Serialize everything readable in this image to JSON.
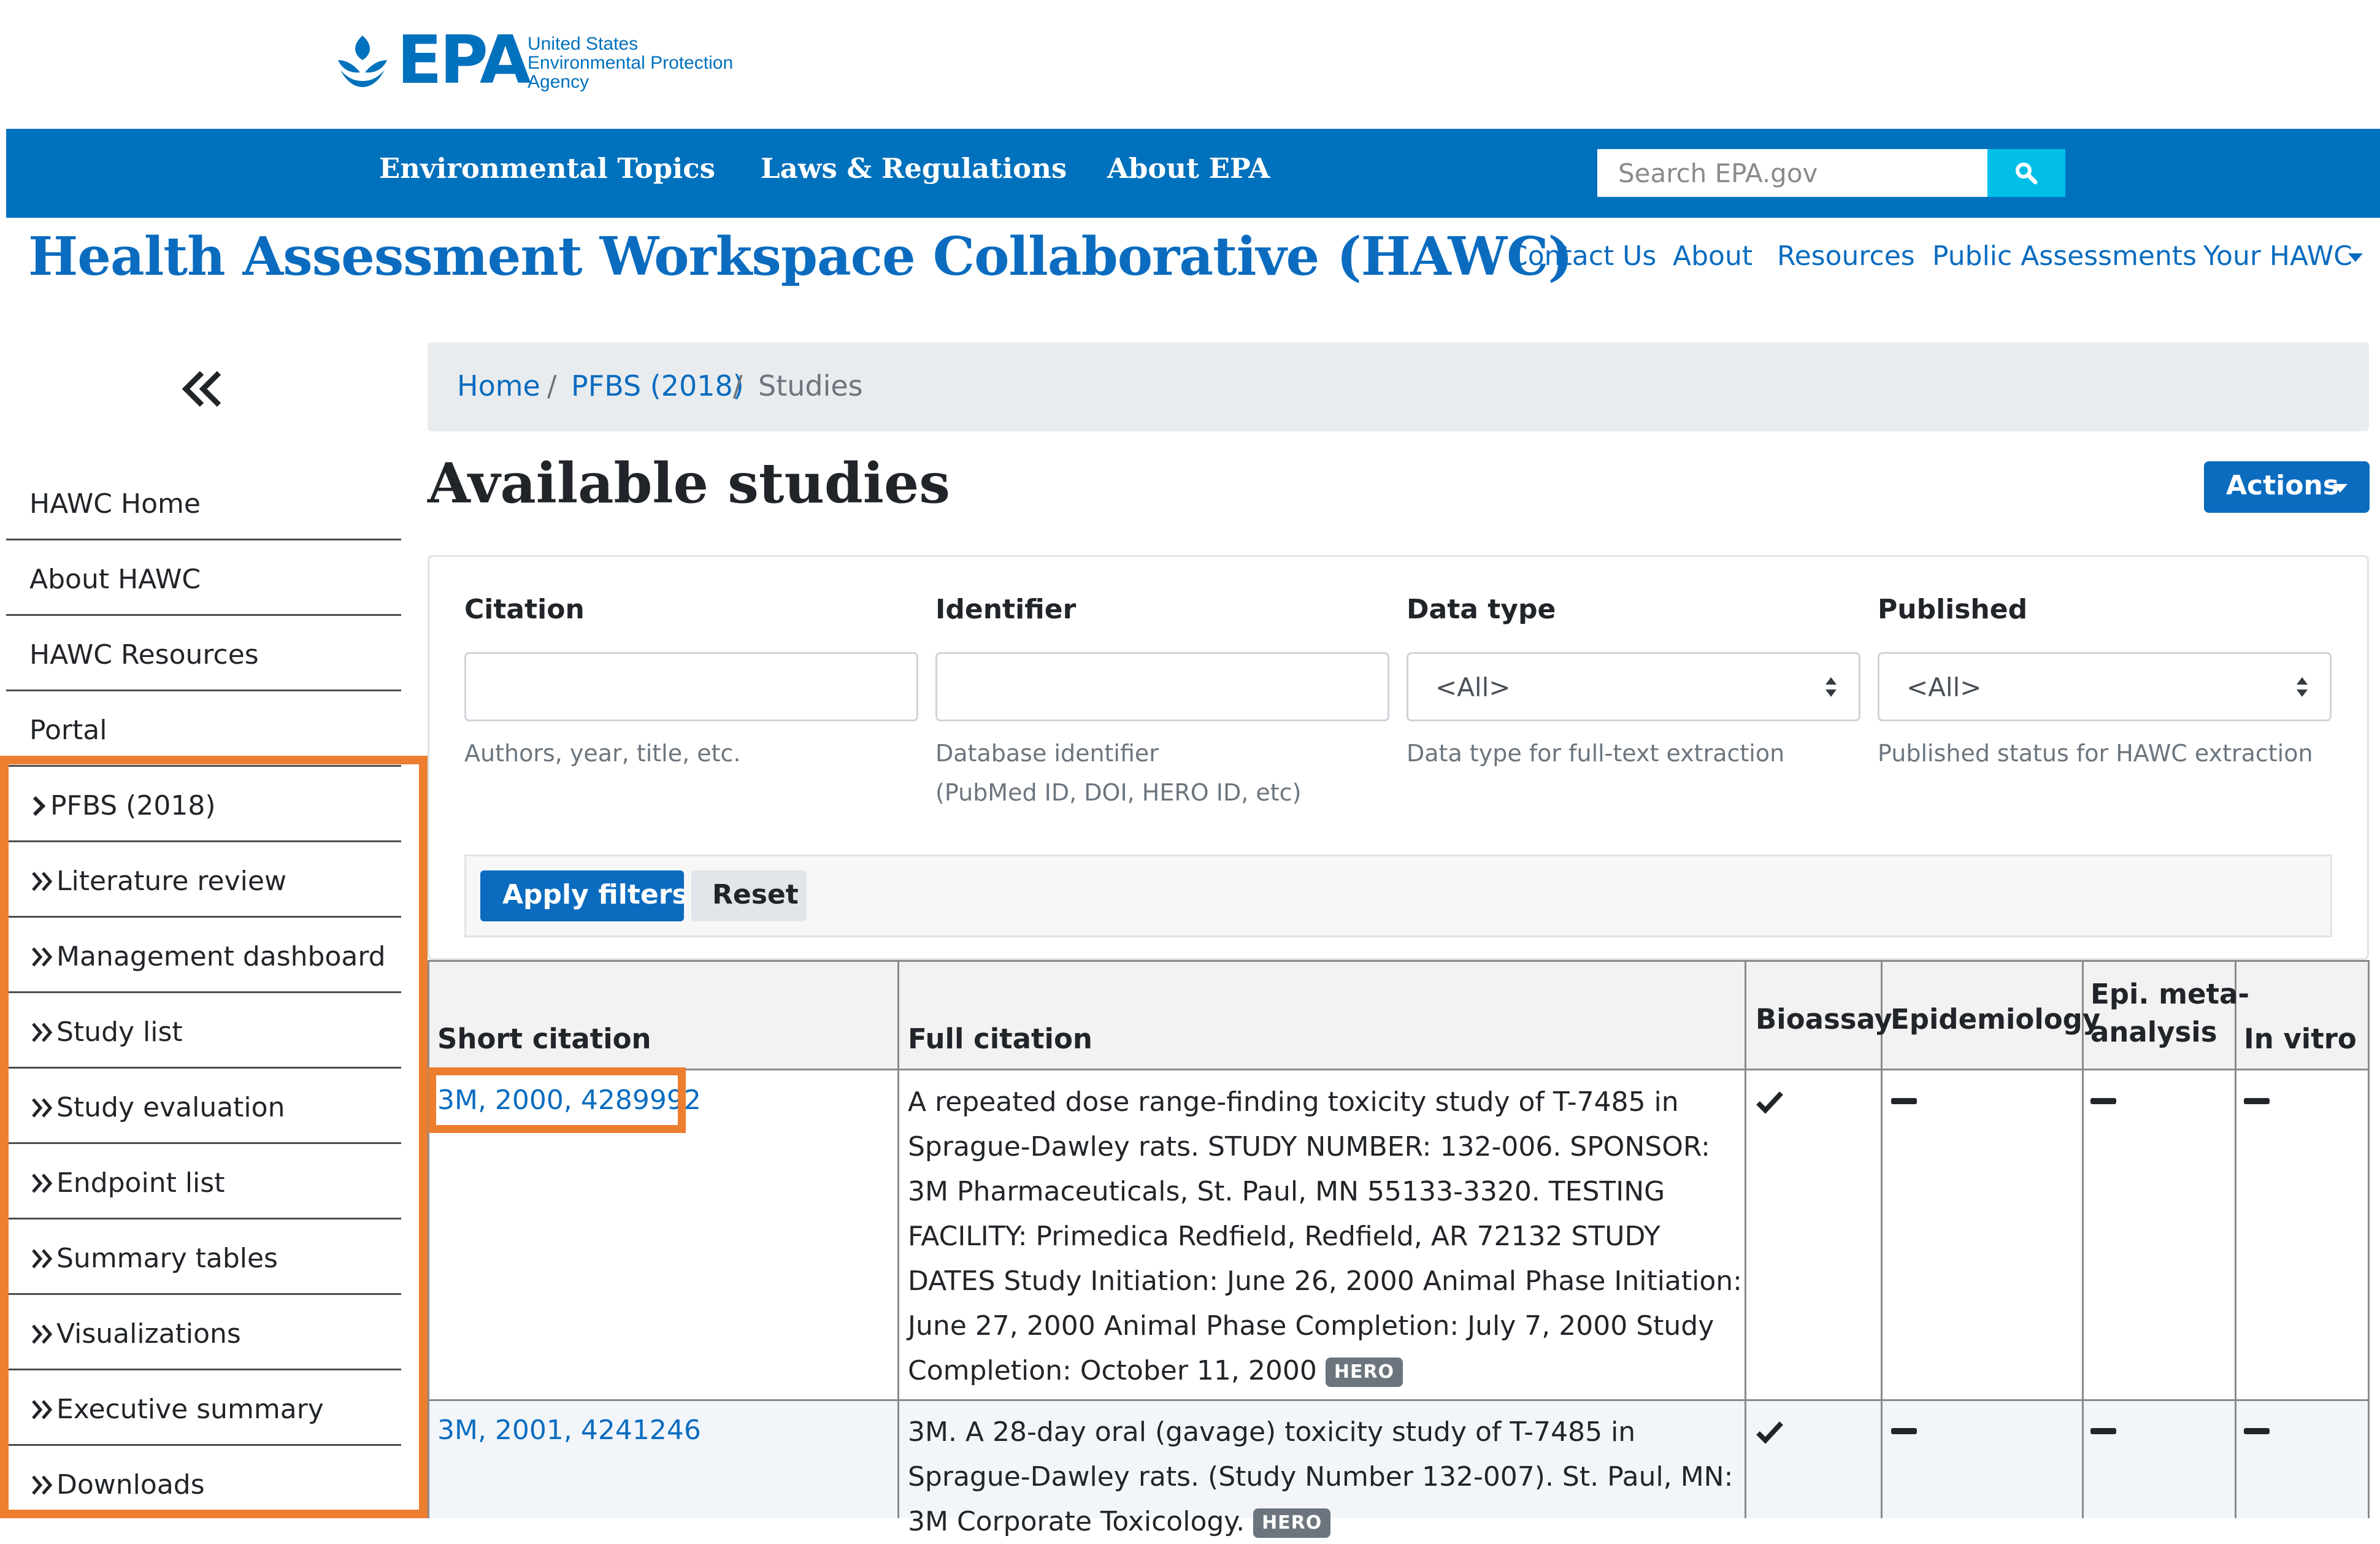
{
  "epa": {
    "logo_text": "EPA",
    "agency_lines": [
      "United States",
      "Environmental Protection",
      "Agency"
    ],
    "nav": [
      "Environmental Topics",
      "Laws & Regulations",
      "About EPA"
    ],
    "search_placeholder": "Search EPA.gov",
    "colors": {
      "brand": "#0071bc",
      "search_button": "#02bfe7"
    }
  },
  "hawc": {
    "title": "Health Assessment Workspace Collaborative (HAWC)",
    "links": [
      "Contact Us",
      "About",
      "Resources",
      "Public Assessments",
      "Your HAWC"
    ]
  },
  "sidebar": {
    "collapse_icon": "double-chevron-left-icon",
    "items": [
      {
        "label": "HAWC Home"
      },
      {
        "label": "About HAWC"
      },
      {
        "label": "HAWC Resources"
      },
      {
        "label": "Portal"
      },
      {
        "label": "PFBS (2018)",
        "icon": "chevron-right-icon"
      },
      {
        "label": "Literature review",
        "icon": "double-chevron-right-icon"
      },
      {
        "label": "Management dashboard",
        "icon": "double-chevron-right-icon"
      },
      {
        "label": "Study list",
        "icon": "double-chevron-right-icon"
      },
      {
        "label": "Study evaluation",
        "icon": "double-chevron-right-icon"
      },
      {
        "label": "Endpoint list",
        "icon": "double-chevron-right-icon"
      },
      {
        "label": "Summary tables",
        "icon": "double-chevron-right-icon"
      },
      {
        "label": "Visualizations",
        "icon": "double-chevron-right-icon"
      },
      {
        "label": "Executive summary",
        "icon": "double-chevron-right-icon"
      },
      {
        "label": "Downloads",
        "icon": "double-chevron-right-icon"
      }
    ],
    "highlight_color": "#ed7e2f"
  },
  "breadcrumb": [
    "Home",
    "PFBS (2018)",
    "Studies"
  ],
  "page_title": "Available studies",
  "actions_label": "Actions",
  "filters": {
    "citation": {
      "label": "Citation",
      "value": "",
      "help": "Authors, year, title, etc."
    },
    "identifier": {
      "label": "Identifier",
      "value": "",
      "help": [
        "Database identifier",
        "(PubMed ID, DOI, HERO ID, etc)"
      ]
    },
    "data_type": {
      "label": "Data type",
      "value": "<All>",
      "help": "Data type for full-text extraction"
    },
    "published": {
      "label": "Published",
      "value": "<All>",
      "help": "Published status for HAWC extraction"
    },
    "apply_label": "Apply filters",
    "reset_label": "Reset"
  },
  "table": {
    "headers": [
      "Short citation",
      "Full citation",
      "Bioassay",
      "Epidemiology",
      "Epi. meta-",
      "analysis",
      "In vitro"
    ],
    "rows": [
      {
        "short": "3M, 2000, 4289992",
        "full": "A repeated dose range-finding toxicity study of T-7485 in Sprague-Dawley rats. STUDY NUMBER: 132-006. SPONSOR: 3M Pharmaceuticals, St. Paul, MN 55133-3320. TESTING FACILITY: Primedica Redfield, Redfield, AR 72132 STUDY DATES Study Initiation: June 26, 2000 Animal Phase Initiation: June 27, 2000 Animal Phase Completion: July 7, 2000 Study Completion: October 11, 2000",
        "badge": "HERO",
        "bioassay": "check-icon",
        "epidemiology": "dash-icon",
        "epi_meta": "dash-icon",
        "in_vitro": "dash-icon"
      },
      {
        "short": "3M, 2001, 4241246",
        "full": "3M. A 28-day oral (gavage) toxicity study of T-7485 in Sprague-Dawley rats. (Study Number 132-007). St. Paul, MN: 3M Corporate Toxicology.",
        "badge": "HERO",
        "bioassay": "check-icon",
        "epidemiology": "dash-icon",
        "epi_meta": "dash-icon",
        "in_vitro": "dash-icon"
      }
    ]
  }
}
